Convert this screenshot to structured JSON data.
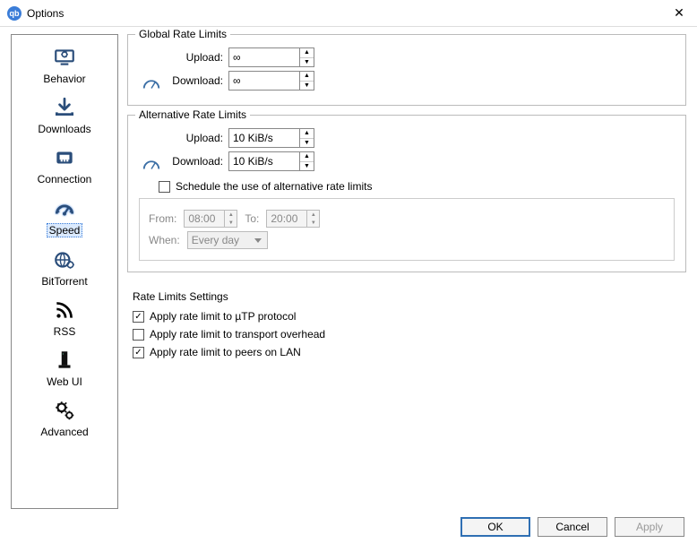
{
  "window": {
    "title": "Options"
  },
  "sidebar": {
    "items": [
      {
        "label": "Behavior"
      },
      {
        "label": "Downloads"
      },
      {
        "label": "Connection"
      },
      {
        "label": "Speed"
      },
      {
        "label": "BitTorrent"
      },
      {
        "label": "RSS"
      },
      {
        "label": "Web UI"
      },
      {
        "label": "Advanced"
      }
    ]
  },
  "global": {
    "legend": "Global Rate Limits",
    "upload_label": "Upload:",
    "download_label": "Download:",
    "upload_value": "∞",
    "download_value": "∞"
  },
  "alt": {
    "legend": "Alternative Rate Limits",
    "upload_label": "Upload:",
    "download_label": "Download:",
    "upload_value": "10 KiB/s",
    "download_value": "10 KiB/s",
    "schedule_label": "Schedule the use of alternative rate limits",
    "schedule_checked": false,
    "from_label": "From:",
    "from_value": "08:00",
    "to_label": "To:",
    "to_value": "20:00",
    "when_label": "When:",
    "when_value": "Every day"
  },
  "settings": {
    "legend": "Rate Limits Settings",
    "opt1_label": "Apply rate limit to µTP protocol",
    "opt1_checked": true,
    "opt2_label": "Apply rate limit to transport overhead",
    "opt2_checked": false,
    "opt3_label": "Apply rate limit to peers on LAN",
    "opt3_checked": true
  },
  "footer": {
    "ok": "OK",
    "cancel": "Cancel",
    "apply": "Apply"
  },
  "glyphs": {
    "check": "✓",
    "up": "▲",
    "down": "▼"
  }
}
